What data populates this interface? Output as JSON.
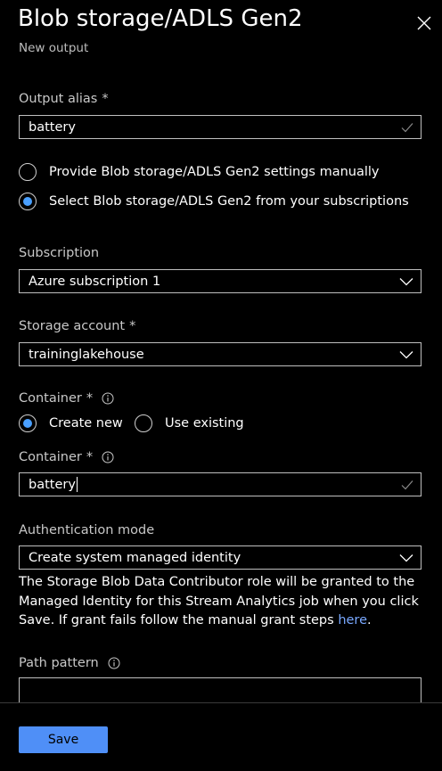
{
  "header": {
    "title": "Blob storage/ADLS Gen2",
    "subtitle": "New output"
  },
  "output_alias": {
    "label": "Output alias",
    "required_mark": "*",
    "value": "battery"
  },
  "settings_mode": {
    "options": [
      {
        "label": "Provide Blob storage/ADLS Gen2 settings manually",
        "selected": false
      },
      {
        "label": "Select Blob storage/ADLS Gen2 from your subscriptions",
        "selected": true
      }
    ]
  },
  "subscription": {
    "label": "Subscription",
    "value": "Azure subscription 1"
  },
  "storage_account": {
    "label": "Storage account",
    "required_mark": "*",
    "value": "traininglakehouse"
  },
  "container_mode": {
    "label": "Container",
    "required_mark": "*",
    "options": [
      {
        "label": "Create new",
        "selected": true
      },
      {
        "label": "Use existing",
        "selected": false
      }
    ]
  },
  "container": {
    "label": "Container",
    "required_mark": "*",
    "value": "battery"
  },
  "authentication": {
    "label": "Authentication mode",
    "value": "Create system managed identity",
    "description": "The Storage Blob Data Contributor role will be granted to the Managed Identity for this Stream Analytics job when you click Save. If grant fails follow the manual grant steps ",
    "link_text": "here",
    "description_end": "."
  },
  "path_pattern": {
    "label": "Path pattern",
    "value": ""
  },
  "footer": {
    "save_label": "Save"
  },
  "colors": {
    "accent": "#4f8ff7",
    "radio_selected": "#4aa0ff",
    "link": "#79a8ff",
    "background": "#000000"
  },
  "icons": [
    "close-icon",
    "checkmark-icon",
    "chevron-down-icon",
    "info-icon"
  ]
}
